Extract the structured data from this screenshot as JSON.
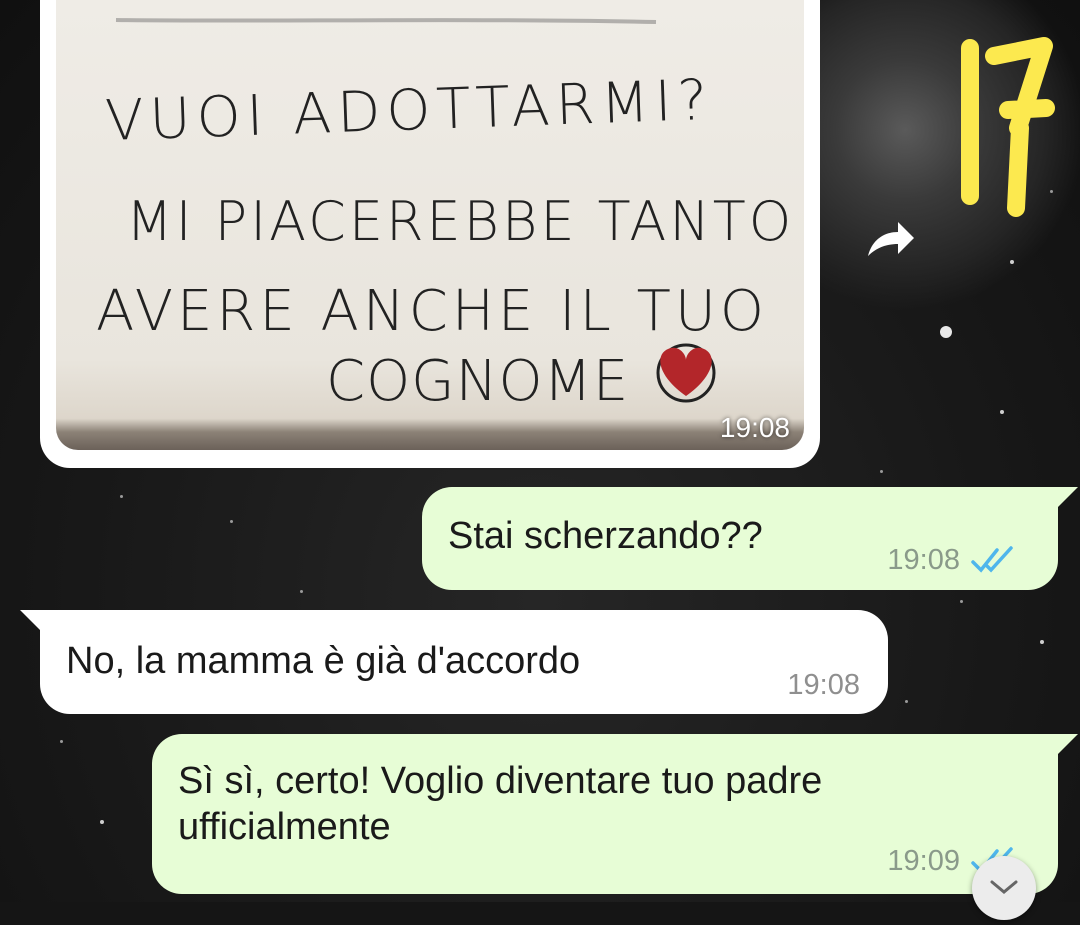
{
  "sticker": {
    "text": "17",
    "color": "#fce94f"
  },
  "image_message": {
    "handwritten_lines": [
      "VUOI ADOTTARMI?",
      "MI PIACEREBBE TANTO",
      "AVERE ANCHE IL TUO",
      "COGNOME"
    ],
    "heart_color": "#b3262a",
    "time": "19:08"
  },
  "forward_icon": "forward-arrow-icon",
  "messages": [
    {
      "direction": "outgoing",
      "text": "Stai scherzando??",
      "time": "19:08",
      "status": "read-double-check"
    },
    {
      "direction": "incoming",
      "text": "No, la mamma è già d'accordo",
      "time": "19:08"
    },
    {
      "direction": "outgoing",
      "text": "Sì sì, certo! Voglio diventare tuo padre ufficialmente",
      "time": "19:09",
      "status": "read-double-check"
    }
  ],
  "colors": {
    "outgoing_bubble": "#e7fdd6",
    "incoming_bubble": "#ffffff",
    "read_ticks": "#4fb6ec",
    "wallpaper": "#151515"
  },
  "scroll_button_icon": "chevron-down-icon"
}
